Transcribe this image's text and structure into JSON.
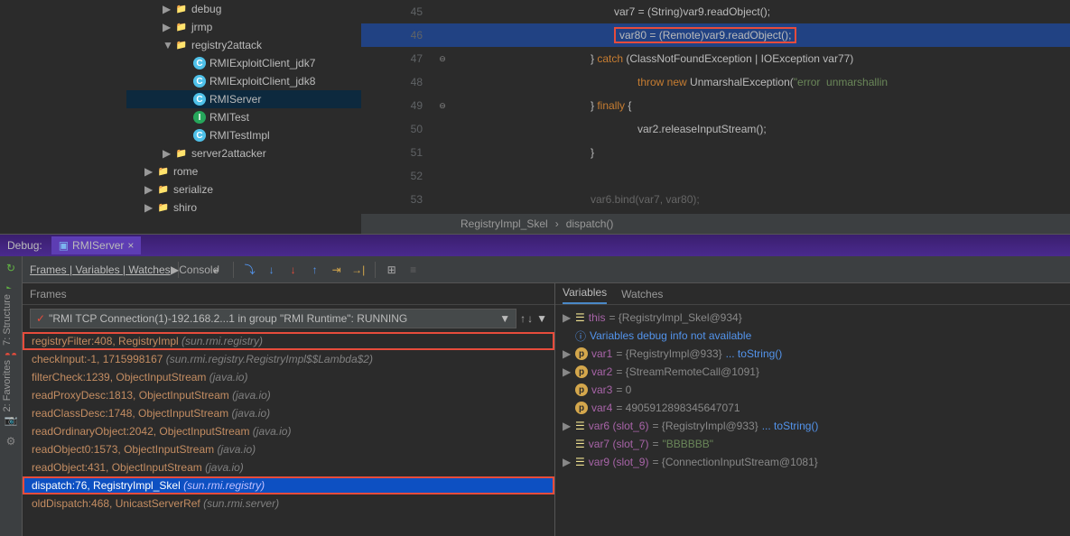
{
  "sideTabs": {
    "structure": "7: Structure",
    "favorites": "2: Favorites"
  },
  "tree": {
    "items": [
      {
        "indent": 0,
        "arrow": "▶",
        "icon": "folder",
        "label": "debug"
      },
      {
        "indent": 0,
        "arrow": "▶",
        "icon": "folder",
        "label": "jrmp"
      },
      {
        "indent": 0,
        "arrow": "▼",
        "icon": "folder",
        "label": "registry2attack"
      },
      {
        "indent": 1,
        "arrow": "",
        "icon": "c",
        "label": "RMIExploitClient_jdk7"
      },
      {
        "indent": 1,
        "arrow": "",
        "icon": "c",
        "label": "RMIExploitClient_jdk8"
      },
      {
        "indent": 1,
        "arrow": "",
        "icon": "c",
        "label": "RMIServer",
        "selected": true
      },
      {
        "indent": 1,
        "arrow": "",
        "icon": "i",
        "label": "RMITest"
      },
      {
        "indent": 1,
        "arrow": "",
        "icon": "c",
        "label": "RMITestImpl"
      },
      {
        "indent": 0,
        "arrow": "▶",
        "icon": "folder",
        "label": "server2attacker"
      },
      {
        "indent": -1,
        "arrow": "▶",
        "icon": "folder",
        "label": "rome"
      },
      {
        "indent": -1,
        "arrow": "▶",
        "icon": "folder",
        "label": "serialize"
      },
      {
        "indent": -1,
        "arrow": "▶",
        "icon": "folder",
        "label": "shiro"
      }
    ]
  },
  "editor": {
    "lines": [
      {
        "num": 45,
        "indent": "",
        "html": "var7 = (<span class='id'>String</span>)var9.readObject();"
      },
      {
        "num": 46,
        "indent": "",
        "html": "var80 = (<span class='id'>Remote</span>)var9.readObject();",
        "hl": true,
        "boxed": true
      },
      {
        "num": 47,
        "indent": "",
        "html": "} <span class='kw'>catch</span> (<span class='id'>ClassNotFoundException</span> | <span class='id'>IOException</span> var77)",
        "back": 1
      },
      {
        "num": 48,
        "indent": "",
        "html": "<span class='kw'>throw new</span> <span class='id'>UnmarshalException</span>(<span class='str'>\"error  unmarshallin</span>",
        "fwd": 1
      },
      {
        "num": 49,
        "indent": "",
        "html": "} <span class='kw'>finally</span> {",
        "back": 1
      },
      {
        "num": 50,
        "indent": "",
        "html": "var2.releaseInputStream();",
        "fwd": 1
      },
      {
        "num": 51,
        "indent": "",
        "html": "}",
        "back": 1
      },
      {
        "num": 52,
        "indent": "",
        "html": ""
      },
      {
        "num": 53,
        "indent": "",
        "html": "<span style='color:#666'>var6.bind(var7, var80);</span>",
        "back": 1
      }
    ],
    "breadcrumb": {
      "class": "RegistryImpl_Skel",
      "method": "dispatch()"
    }
  },
  "debug": {
    "title": "Debug:",
    "tab": "RMIServer",
    "tabs": "Frames | Variables | Watches",
    "console": "Console",
    "framesHeader": "Frames",
    "thread": "\"RMI TCP Connection(1)-192.168.2...1 in group \"RMI Runtime\": RUNNING",
    "frames": [
      {
        "text": "registryFilter:408, RegistryImpl",
        "pkg": "(sun.rmi.registry)",
        "boxed": true
      },
      {
        "text": "checkInput:-1, 1715998167",
        "pkg": "(sun.rmi.registry.RegistryImpl$$Lambda$2)"
      },
      {
        "text": "filterCheck:1239, ObjectInputStream",
        "pkg": "(java.io)"
      },
      {
        "text": "readProxyDesc:1813, ObjectInputStream",
        "pkg": "(java.io)"
      },
      {
        "text": "readClassDesc:1748, ObjectInputStream",
        "pkg": "(java.io)"
      },
      {
        "text": "readOrdinaryObject:2042, ObjectInputStream",
        "pkg": "(java.io)"
      },
      {
        "text": "readObject0:1573, ObjectInputStream",
        "pkg": "(java.io)"
      },
      {
        "text": "readObject:431, ObjectInputStream",
        "pkg": "(java.io)"
      },
      {
        "text": "dispatch:76, RegistryImpl_Skel",
        "pkg": "(sun.rmi.registry)",
        "boxed": true,
        "selected": true
      },
      {
        "text": "oldDispatch:468, UnicastServerRef",
        "pkg": "(sun.rmi.server)"
      }
    ],
    "varsTab": "Variables",
    "watchesTab": "Watches",
    "vars": [
      {
        "expand": "▶",
        "badge": "eq",
        "name": "this",
        "val": "= {RegistryImpl_Skel@934}"
      },
      {
        "expand": "",
        "badge": "info",
        "name": "",
        "info": "Variables debug info not available"
      },
      {
        "expand": "▶",
        "badge": "p",
        "name": "var1",
        "val": "= {RegistryImpl@933}",
        "link": "... toString()"
      },
      {
        "expand": "▶",
        "badge": "p",
        "name": "var2",
        "val": "= {StreamRemoteCall@1091}"
      },
      {
        "expand": "",
        "badge": "p",
        "name": "var3",
        "val": "= 0"
      },
      {
        "expand": "",
        "badge": "p",
        "name": "var4",
        "val": "= 4905912898345647071"
      },
      {
        "expand": "▶",
        "badge": "eq",
        "name": "var6 (slot_6)",
        "val": "= {RegistryImpl@933}",
        "link": "... toString()"
      },
      {
        "expand": "",
        "badge": "eq",
        "name": "var7 (slot_7)",
        "val": "= ",
        "str": "\"BBBBBB\""
      },
      {
        "expand": "▶",
        "badge": "eq",
        "name": "var9 (slot_9)",
        "val": "= {ConnectionInputStream@1081}"
      }
    ]
  }
}
